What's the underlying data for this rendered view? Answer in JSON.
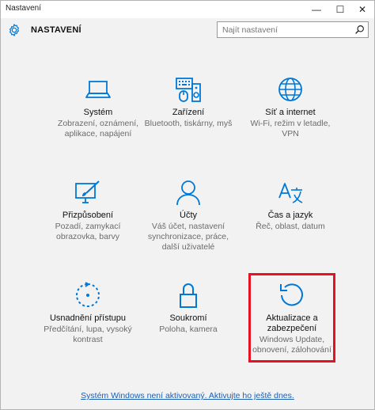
{
  "window": {
    "title": "Nastavení",
    "minimize_glyph": "—",
    "maximize_glyph": "☐",
    "close_glyph": "✕"
  },
  "header": {
    "title": "NASTAVENÍ",
    "icon": "gear-icon"
  },
  "search": {
    "placeholder": "Najít nastavení",
    "value": ""
  },
  "colors": {
    "accent": "#0078d7",
    "highlight": "#e81123",
    "link": "#1a5fb4"
  },
  "tiles": [
    {
      "icon": "laptop-icon",
      "title": "Systém",
      "desc": [
        "Zobrazení, oznámení,",
        "aplikace, napájení"
      ]
    },
    {
      "icon": "devices-icon",
      "title": "Zařízení",
      "desc": [
        "Bluetooth, tiskárny, myš"
      ]
    },
    {
      "icon": "globe-icon",
      "title": "Síť a internet",
      "desc": [
        "Wi-Fi, režim v letadle,",
        "VPN"
      ]
    },
    {
      "icon": "personalization-icon",
      "title": "Přizpůsobení",
      "desc": [
        "Pozadí, zamykací",
        "obrazovka, barvy"
      ]
    },
    {
      "icon": "person-icon",
      "title": "Účty",
      "desc": [
        "Váš účet, nastavení",
        "synchronizace, práce,",
        "další uživatelé"
      ]
    },
    {
      "icon": "time-language-icon",
      "title": "Čas a jazyk",
      "desc": [
        "Řeč, oblast, datum"
      ]
    },
    {
      "icon": "accessibility-icon",
      "title": "Usnadnění přístupu",
      "desc": [
        "Předčítání, lupa, vysoký",
        "kontrast"
      ]
    },
    {
      "icon": "lock-icon",
      "title": "Soukromí",
      "desc": [
        "Poloha, kamera"
      ]
    },
    {
      "icon": "update-icon",
      "title": [
        "Aktualizace a",
        "zabezpečení"
      ],
      "desc": [
        "Windows Update,",
        "obnovení, zálohování"
      ]
    }
  ],
  "footer": {
    "link": "Systém Windows není aktivovaný. Aktivujte ho ještě dnes."
  }
}
